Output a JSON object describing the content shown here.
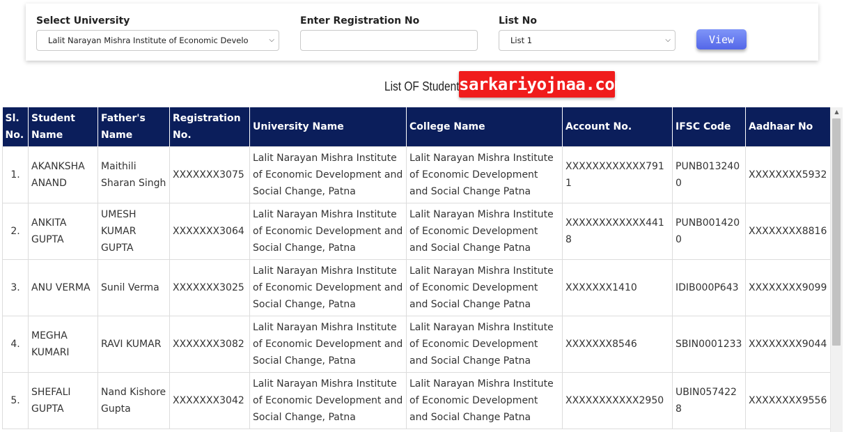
{
  "filters": {
    "university_label": "Select University",
    "university_value": "Lalit Narayan Mishra Institute of Economic Develo",
    "registration_label": "Enter Registration No",
    "registration_value": "",
    "list_label": "List No",
    "list_value": "List 1",
    "view_button": "View"
  },
  "list_title": "List OF Student",
  "watermark": "sarkariyojnaa.com",
  "table": {
    "headers": [
      "Sl. No.",
      "Student Name",
      "Father's Name",
      "Registration No.",
      "University Name",
      "College Name",
      "Account No.",
      "IFSC Code",
      "Aadhaar No"
    ],
    "rows": [
      [
        "1.",
        "AKANKSHA ANAND",
        "Maithili Sharan Singh",
        "XXXXXXX3075",
        "Lalit Narayan Mishra Institute of Economic Development and Social Change, Patna",
        "Lalit Narayan Mishra Institute of Economic Development and Social Change Patna",
        "XXXXXXXXXXXX7911",
        "PUNB0132400",
        "XXXXXXXX5932"
      ],
      [
        "2.",
        "ANKITA GUPTA",
        "UMESH KUMAR GUPTA",
        "XXXXXXX3064",
        "Lalit Narayan Mishra Institute of Economic Development and Social Change, Patna",
        "Lalit Narayan Mishra Institute of Economic Development and Social Change Patna",
        "XXXXXXXXXXXX4418",
        "PUNB0014200",
        "XXXXXXXX8816"
      ],
      [
        "3.",
        "ANU VERMA",
        "Sunil Verma",
        "XXXXXXX3025",
        "Lalit Narayan Mishra Institute of Economic Development and Social Change, Patna",
        "Lalit Narayan Mishra Institute of Economic Development and Social Change Patna",
        "XXXXXXX1410",
        "IDIB000P643",
        "XXXXXXXX9099"
      ],
      [
        "4.",
        "MEGHA KUMARI",
        "RAVI KUMAR",
        "XXXXXXX3082",
        "Lalit Narayan Mishra Institute of Economic Development and Social Change, Patna",
        "Lalit Narayan Mishra Institute of Economic Development and Social Change Patna",
        "XXXXXXX8546",
        "SBIN0001233",
        "XXXXXXXX9044"
      ],
      [
        "5.",
        "SHEFALI GUPTA",
        "Nand Kishore Gupta",
        "XXXXXXX3042",
        "Lalit Narayan Mishra Institute of Economic Development and Social Change, Patna",
        "Lalit Narayan Mishra Institute of Economic Development and Social Change Patna",
        "XXXXXXXXXXX2950",
        "UBIN0574228",
        "XXXXXXXX9556"
      ]
    ]
  },
  "icons": {
    "dropdown": "chevron-down-icon",
    "scroll_up": "scroll-up-arrow-icon"
  }
}
